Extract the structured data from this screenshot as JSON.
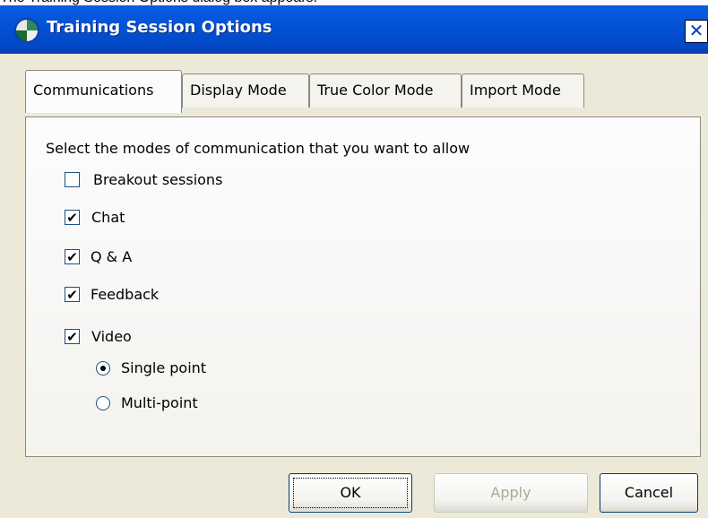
{
  "caption": "The Training Session Options dialog box appears.",
  "dialog": {
    "title": "Training Session Options",
    "close_glyph": "✕",
    "icon": "app-globe-icon"
  },
  "tabs": [
    {
      "label": "Communications",
      "active": true
    },
    {
      "label": "Display Mode",
      "active": false
    },
    {
      "label": "True Color Mode",
      "active": false
    },
    {
      "label": "Import Mode",
      "active": false
    }
  ],
  "panel": {
    "instruction": "Select the modes of communication that you want to allow",
    "options": [
      {
        "label": "Breakout sessions",
        "checked": false
      },
      {
        "label": "Chat",
        "checked": true
      },
      {
        "label": "Q & A",
        "checked": true
      },
      {
        "label": "Feedback",
        "checked": true
      },
      {
        "label": "Video",
        "checked": true
      }
    ],
    "video_modes": [
      {
        "label": "Single point",
        "selected": true
      },
      {
        "label": "Multi-point",
        "selected": false
      }
    ]
  },
  "buttons": {
    "ok": "OK",
    "apply": "Apply",
    "cancel": "Cancel"
  }
}
